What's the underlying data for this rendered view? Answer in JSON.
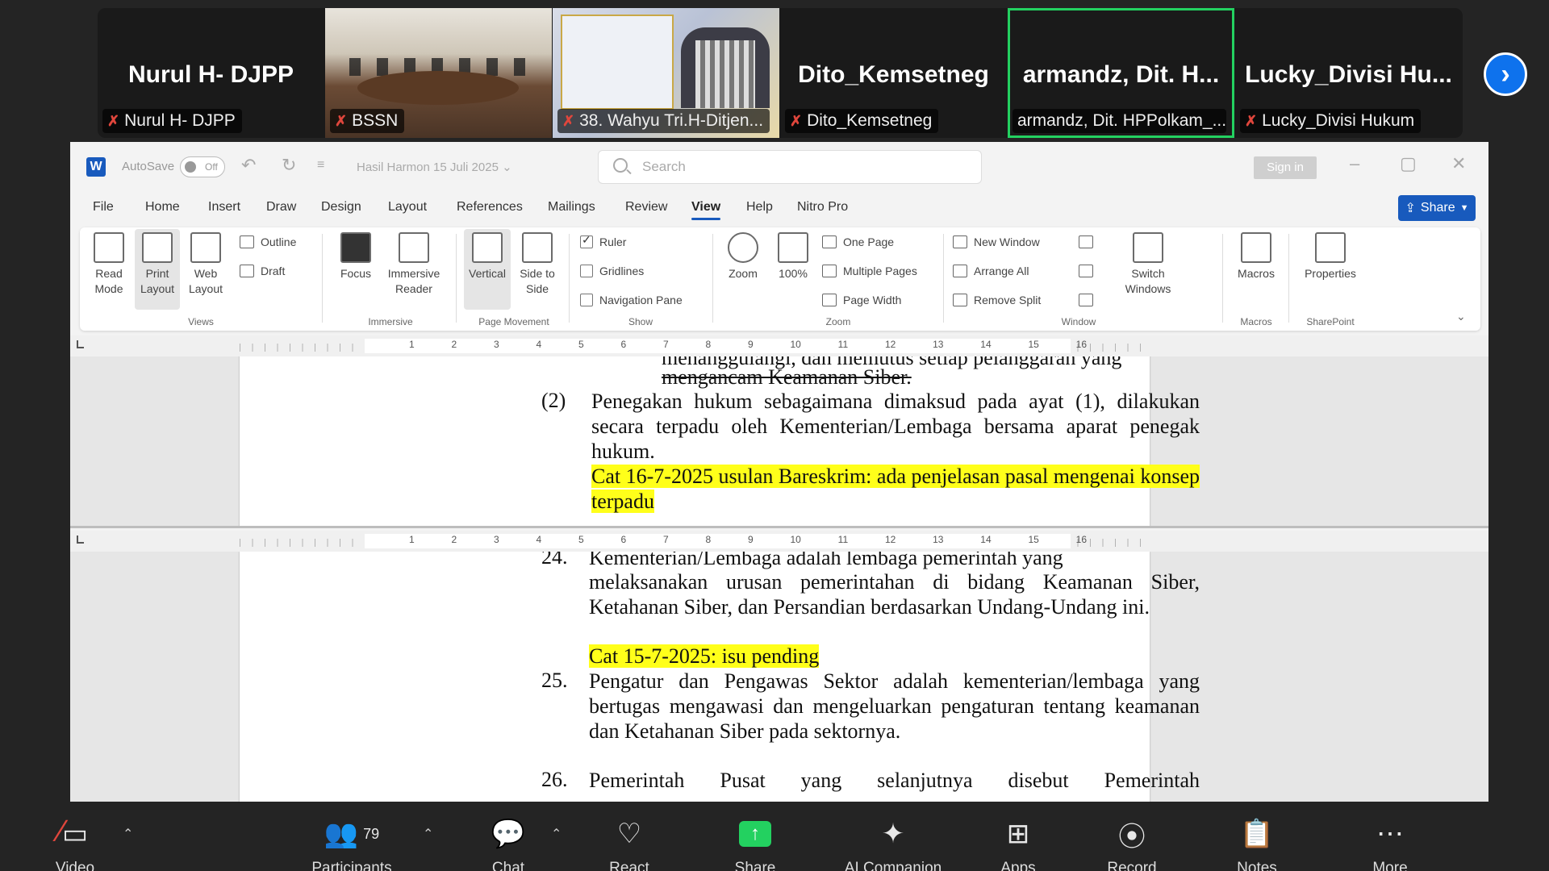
{
  "participants": [
    {
      "big_name": "Nurul H- DJPP",
      "label": "Nurul H- DJPP",
      "video": false
    },
    {
      "big_name": "",
      "label": "BSSN",
      "video": true
    },
    {
      "big_name": "",
      "label": "38. Wahyu Tri.H-Ditjen...",
      "video": true
    },
    {
      "big_name": "Dito_Kemsetneg",
      "label": "Dito_Kemsetneg",
      "video": false
    },
    {
      "big_name": "armandz, Dit. H...",
      "label": "armandz, Dit. HPPolkam_...",
      "video": false,
      "speaking": true
    },
    {
      "big_name": "Lucky_Divisi Hu...",
      "label": "Lucky_Divisi Hukum",
      "video": false
    }
  ],
  "word": {
    "titlebar": {
      "logo": "W",
      "autosave_label": "AutoSave",
      "toggle_label": "Off",
      "doc_name": "Hasil Harmon 15 Juli 2025 ⌄",
      "search_placeholder": "Search",
      "sign_in": "Sign in"
    },
    "tabs": [
      "File",
      "Home",
      "Insert",
      "Draw",
      "Design",
      "Layout",
      "References",
      "Mailings",
      "Review",
      "View",
      "Help",
      "Nitro Pro"
    ],
    "active_tab": "View",
    "share_label": "Share",
    "ribbon": {
      "views": {
        "read_mode": "Read Mode",
        "print_layout": "Print Layout",
        "web_layout": "Web Layout",
        "outline": "Outline",
        "draft": "Draft",
        "group": "Views"
      },
      "immersive": {
        "focus": "Focus",
        "reader": "Immersive Reader",
        "group": "Immersive"
      },
      "page_movement": {
        "vertical": "Vertical",
        "side": "Side to Side",
        "group": "Page Movement"
      },
      "show": {
        "ruler": "Ruler",
        "gridlines": "Gridlines",
        "nav": "Navigation Pane",
        "group": "Show",
        "ruler_checked": true,
        "gridlines_checked": false,
        "nav_checked": false
      },
      "zoom": {
        "zoom": "Zoom",
        "hundred": "100%",
        "one_page": "One Page",
        "multiple_pages": "Multiple Pages",
        "page_width": "Page Width",
        "group": "Zoom"
      },
      "window": {
        "new_window": "New Window",
        "arrange_all": "Arrange All",
        "remove_split": "Remove Split",
        "switch": "Switch Windows",
        "group": "Window"
      },
      "macros": {
        "label": "Macros",
        "group": "Macros"
      },
      "sharepoint": {
        "label": "Properties",
        "group": "SharePoint"
      }
    },
    "ruler_numbers": [
      "1",
      "2",
      "3",
      "4",
      "5",
      "6",
      "7",
      "8",
      "9",
      "10",
      "11",
      "12",
      "13",
      "14",
      "15",
      "16"
    ],
    "pane1": {
      "cut_line": "menanggulangi, dan memutus setiap pelanggaran yang",
      "line_prev": "mengancam Keamanan Siber.",
      "item_num": "(2)",
      "paragraph": "Penegakan hukum sebagaimana dimaksud pada ayat (1), dilakukan secara terpadu oleh Kementerian/Lembaga bersama aparat penegak hukum.",
      "comment": "Cat 16-7-2025 usulan Bareskrim: ada penjelasan pasal mengenai konsep terpadu"
    },
    "pane2": {
      "item24_num": "24.",
      "item24_cut": "Kementerian/Lembaga adalah lembaga pemerintah yang",
      "item24_text": "melaksanakan urusan pemerintahan di bidang Keamanan Siber, Ketahanan Siber, dan Persandian berdasarkan Undang-Undang ini.",
      "comment": "Cat 15-7-2025: isu pending",
      "item25_num": "25.",
      "item25_text": "Pengatur dan Pengawas Sektor adalah kementerian/lembaga yang bertugas mengawasi dan mengeluarkan pengaturan tentang keamanan dan Ketahanan Siber pada sektornya.",
      "item26_num": "26.",
      "item26_text": "Pemerintah Pusat yang selanjutnya disebut Pemerintah"
    }
  },
  "toolbar": {
    "video": "Video",
    "participants": "Participants",
    "participant_count": "79",
    "chat": "Chat",
    "react": "React",
    "share": "Share",
    "ai": "AI Companion",
    "apps": "Apps",
    "record": "Record",
    "notes": "Notes",
    "more": "More"
  },
  "colors": {
    "highlight": "#ffff1a",
    "word_blue": "#185abd",
    "zoom_green": "#23d160",
    "zoom_blue": "#0e72ed"
  }
}
